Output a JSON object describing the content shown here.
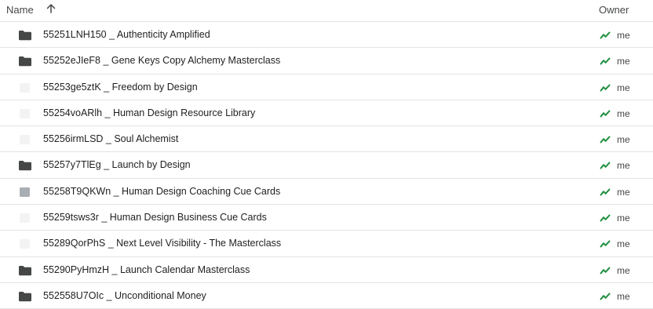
{
  "header": {
    "name_label": "Name",
    "sort_icon": "arrow-up-icon",
    "owner_label": "Owner"
  },
  "colors": {
    "folder": "#444746",
    "shared_icon": "#1e8e3e",
    "divider": "#e3e3e3"
  },
  "rows": [
    {
      "name": "55251LNH150 _ Authenticity Amplified",
      "owner": "me",
      "icon": "folder-icon"
    },
    {
      "name": "55252eJIeF8 _ Gene Keys Copy Alchemy Masterclass",
      "owner": "me",
      "icon": "folder-icon"
    },
    {
      "name": "55253ge5ztK _ Freedom by Design",
      "owner": "me",
      "icon": "file-thumbnail-icon"
    },
    {
      "name": "55254voARlh _ Human Design Resource Library",
      "owner": "me",
      "icon": "file-thumbnail-icon"
    },
    {
      "name": "55256irmLSD _ Soul Alchemist",
      "owner": "me",
      "icon": "file-thumbnail-icon"
    },
    {
      "name": "55257y7TlEg _ Launch by Design",
      "owner": "me",
      "icon": "folder-icon"
    },
    {
      "name": "55258T9QKWn _ Human Design Coaching Cue Cards",
      "owner": "me",
      "icon": "file-thumbnail-icon"
    },
    {
      "name": "55259tsws3r _ Human Design Business Cue Cards",
      "owner": "me",
      "icon": "file-thumbnail-icon"
    },
    {
      "name": "55289QorPhS _ Next Level Visibility - The Masterclass",
      "owner": "me",
      "icon": "file-thumbnail-icon"
    },
    {
      "name": "55290PyHmzH _ Launch Calendar Masterclass",
      "owner": "me",
      "icon": "folder-icon"
    },
    {
      "name": "552558U7OIc _ Unconditional Money",
      "owner": "me",
      "icon": "folder-icon"
    }
  ]
}
